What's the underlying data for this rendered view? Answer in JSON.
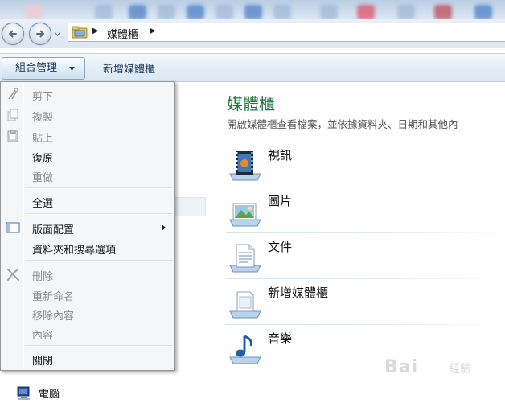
{
  "address_bar": {
    "breadcrumb": "媒體櫃"
  },
  "command_bar": {
    "organize_label": "組合管理",
    "new_library_label": "新增媒體櫃"
  },
  "organize_menu": {
    "items": [
      {
        "label": "剪下",
        "icon": "scissors-icon",
        "enabled": false
      },
      {
        "label": "複製",
        "icon": "copy-icon",
        "enabled": false
      },
      {
        "label": "貼上",
        "icon": "paste-icon",
        "enabled": false
      },
      {
        "label": "復原",
        "icon": "",
        "enabled": true
      },
      {
        "label": "重做",
        "icon": "",
        "enabled": false
      },
      {
        "label": "全選",
        "icon": "",
        "enabled": true
      },
      {
        "label": "版面配置",
        "icon": "layout-icon",
        "enabled": true,
        "submenu": true
      },
      {
        "label": "資料夾和搜尋選項",
        "icon": "",
        "enabled": true
      },
      {
        "label": "刪除",
        "icon": "delete-x-icon",
        "enabled": false
      },
      {
        "label": "重新命名",
        "icon": "",
        "enabled": false
      },
      {
        "label": "移除內容",
        "icon": "",
        "enabled": false
      },
      {
        "label": "內容",
        "icon": "",
        "enabled": false
      },
      {
        "label": "關閉",
        "icon": "",
        "enabled": true
      }
    ]
  },
  "nav_pane": {
    "computer_label": "電腦"
  },
  "content": {
    "title": "媒體櫃",
    "description": "開啟媒體櫃查看檔案，並依據資料夾、日期和其他內",
    "libraries": [
      {
        "label": "視訊",
        "icon": "video-library-icon"
      },
      {
        "label": "圖片",
        "icon": "pictures-library-icon"
      },
      {
        "label": "文件",
        "icon": "documents-library-icon"
      },
      {
        "label": "新增媒體櫃",
        "icon": "new-library-icon"
      },
      {
        "label": "音樂",
        "icon": "music-library-icon"
      }
    ]
  },
  "watermark": {
    "text": "Bai",
    "sub": "經驗"
  },
  "colors": {
    "title_green": "#1c7a3f",
    "cmdbar_text": "#1e3955",
    "menu_bg": "#f5f6f7",
    "disabled_text": "#8d8d8d"
  }
}
